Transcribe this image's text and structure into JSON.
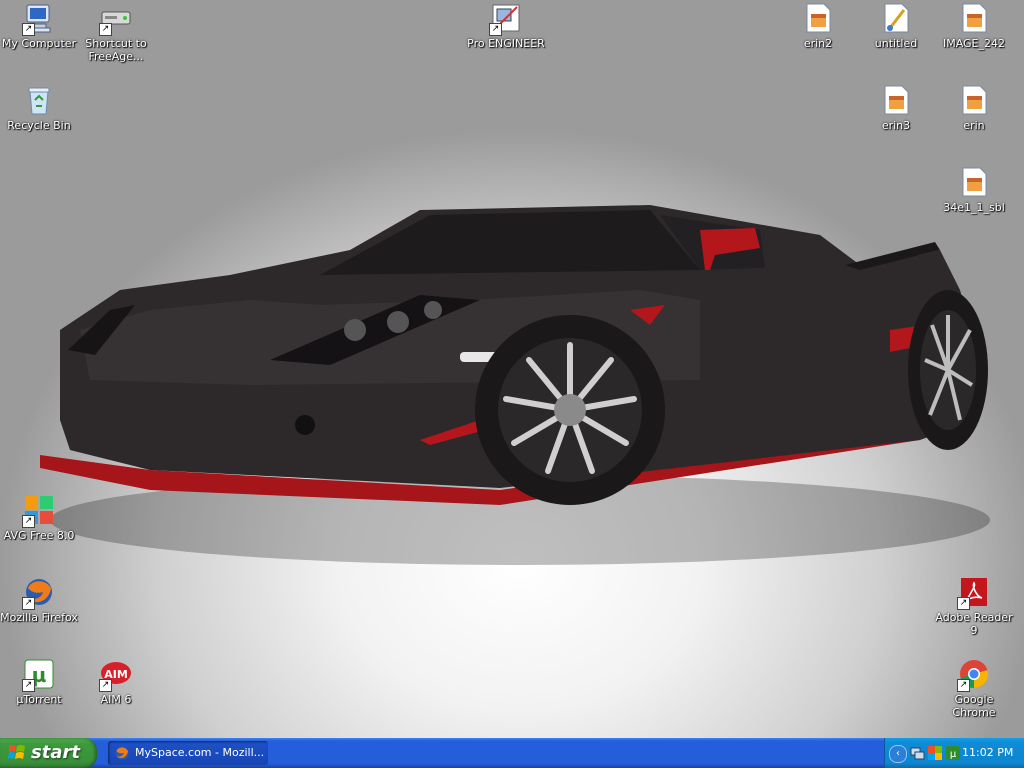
{
  "desktop": {
    "icons": {
      "my_computer": "My Computer",
      "freeagent": "Shortcut to FreeAge...",
      "pro_engineer": "Pro ENGINEER",
      "erin2": "erin2",
      "untitled": "untitled",
      "image_242": "IMAGE_242",
      "recycle_bin": "Recycle Bin",
      "erin3": "erin3",
      "erin": "erin",
      "sbl": "34e1_1_sbl",
      "avg": "AVG Free 8.0",
      "firefox": "Mozilla Firefox",
      "utorrent": "µTorrent",
      "aim": "AIM 6",
      "adobe": "Adobe Reader 9",
      "chrome": "Google Chrome"
    }
  },
  "taskbar": {
    "start_label": "start",
    "window_title": "MySpace.com - Mozill...",
    "clock": "11:02 PM"
  },
  "colors": {
    "taskbar_blue": "#245edb",
    "start_green": "#3c9a3c",
    "tray_blue": "#0f8bd6",
    "car_body": "#2e2a2c",
    "car_accent_red": "#b3161b"
  }
}
